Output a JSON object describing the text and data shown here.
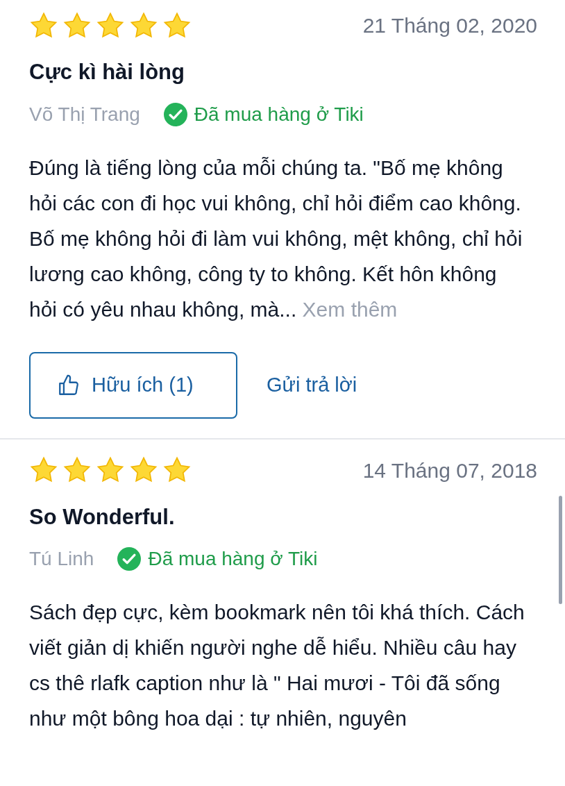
{
  "reviews": [
    {
      "stars": 5,
      "date": "21 Tháng 02, 2020",
      "title": "Cực kì hài lòng",
      "author": "Võ Thị Trang",
      "verified": "Đã mua hàng ở Tiki",
      "body": "Đúng là tiếng lòng của mỗi chúng ta. \"Bố mẹ không hỏi các con đi học vui không, chỉ hỏi điểm cao không. Bố mẹ không hỏi đi làm vui không, mệt không, chỉ hỏi lương cao không, công ty to không. Kết hôn không hỏi có yêu nhau không, mà...",
      "more": "Xem thêm",
      "helpful": "Hữu ích (1)",
      "reply": "Gửi trả lời"
    },
    {
      "stars": 5,
      "date": "14 Tháng 07, 2018",
      "title": "So Wonderful.",
      "author": "Tú Linh",
      "verified": "Đã mua hàng ở Tiki",
      "body": "Sách đẹp cực, kèm bookmark nên tôi khá thích. Cách viết giản dị khiến người nghe dễ hiểu. Nhiều câu hay cs thê rlafk caption như là \" Hai mươi - Tôi đã sống như một bông hoa dại : tự nhiên, nguyên"
    }
  ]
}
